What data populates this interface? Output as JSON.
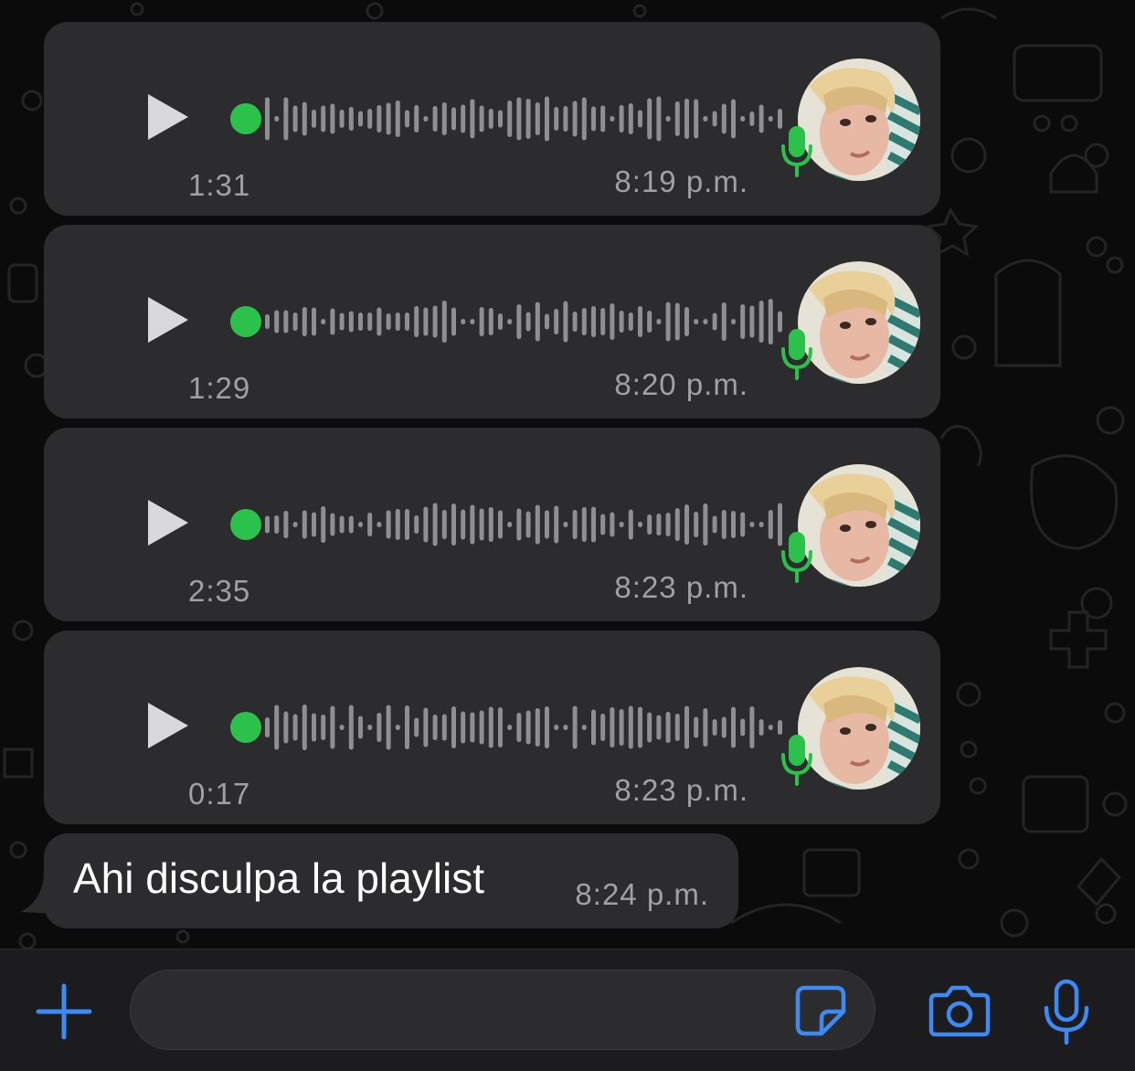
{
  "colors": {
    "accent": "#3d8af7",
    "waveform_dot": "#2bc24c",
    "mic_badge": "#2bc24c",
    "bubble": "#2c2c2e",
    "meta_text": "#a0a0a5"
  },
  "voice_messages": [
    {
      "duration": "1:31",
      "time": "8:19 p.m.",
      "played": false
    },
    {
      "duration": "1:29",
      "time": "8:20 p.m.",
      "played": false
    },
    {
      "duration": "2:35",
      "time": "8:23 p.m.",
      "played": false
    },
    {
      "duration": "0:17",
      "time": "8:23 p.m.",
      "played": false
    }
  ],
  "text_message": {
    "text": "Ahi disculpa la playlist",
    "time": "8:24 p.m."
  },
  "input_bar": {
    "icons": [
      "plus-icon",
      "sticker-icon",
      "camera-icon",
      "microphone-icon"
    ]
  }
}
